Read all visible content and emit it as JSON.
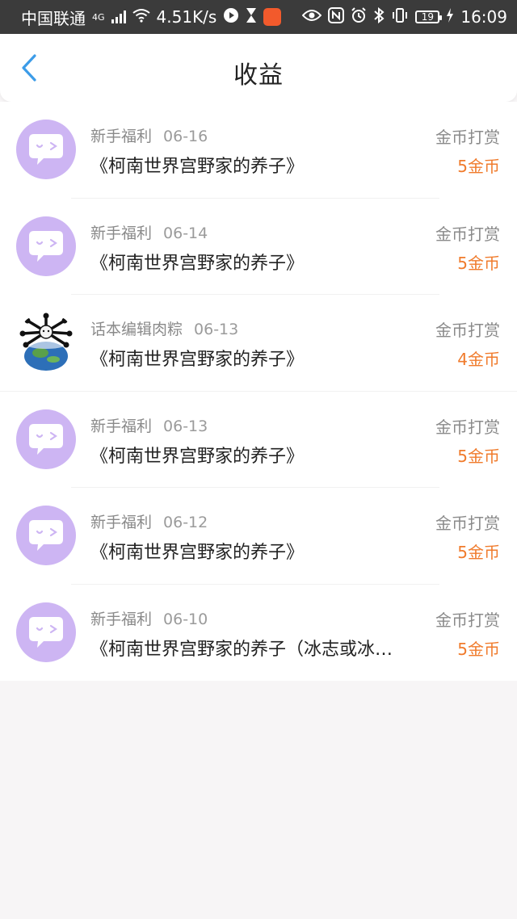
{
  "status_bar": {
    "carrier": "中国联通",
    "network_type": "4G",
    "speed": "4.51K/s",
    "battery": "19",
    "time": "16:09"
  },
  "header": {
    "title": "收益"
  },
  "colors": {
    "accent_blue": "#3c9ce8",
    "amount_orange": "#f07b2c",
    "avatar_purple": "#cdb5f3"
  },
  "records": [
    {
      "source": "新手福利",
      "date": "06-16",
      "book": "《柯南世界宫野家的养子》",
      "type": "金币打赏",
      "amount": "5金币",
      "avatar": "chat-bubble-icon"
    },
    {
      "source": "新手福利",
      "date": "06-14",
      "book": "《柯南世界宫野家的养子》",
      "type": "金币打赏",
      "amount": "5金币",
      "avatar": "chat-bubble-icon"
    },
    {
      "source": "话本编辑肉粽",
      "date": "06-13",
      "book": "《柯南世界宫野家的养子》",
      "type": "金币打赏",
      "amount": "4金币",
      "avatar": "user-photo"
    },
    {
      "source": "新手福利",
      "date": "06-13",
      "book": "《柯南世界宫野家的养子》",
      "type": "金币打赏",
      "amount": "5金币",
      "avatar": "chat-bubble-icon"
    },
    {
      "source": "新手福利",
      "date": "06-12",
      "book": "《柯南世界宫野家的养子》",
      "type": "金币打赏",
      "amount": "5金币",
      "avatar": "chat-bubble-icon"
    },
    {
      "source": "新手福利",
      "date": "06-10",
      "book": "《柯南世界宫野家的养子（冰志或冰…",
      "type": "金币打赏",
      "amount": "5金币",
      "avatar": "chat-bubble-icon"
    }
  ]
}
